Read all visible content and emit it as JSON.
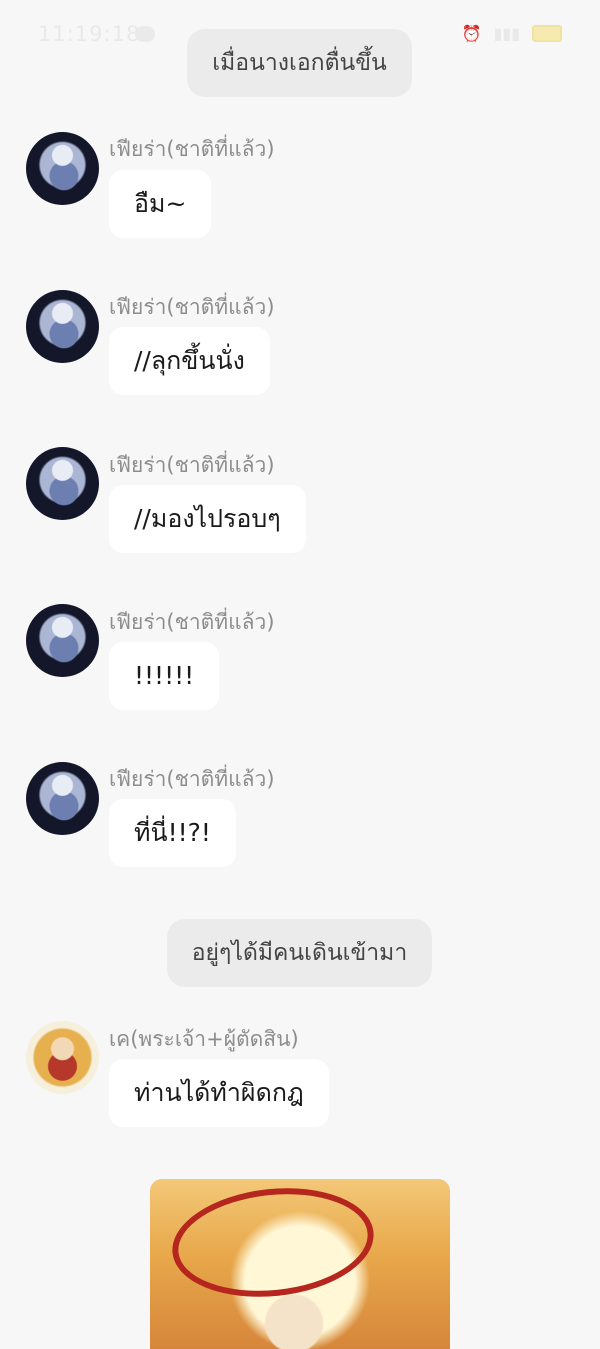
{
  "status_bar": {
    "time": "11:19:18",
    "battery": "85"
  },
  "system_messages": [
    "เมื่อนางเอกตื่นขึ้น",
    "อยู่ๆได้มีคนเดินเข้ามา"
  ],
  "messages": [
    {
      "sender": "เฟียร่า(ชาติที่แล้ว)",
      "text": "อืม~"
    },
    {
      "sender": "เฟียร่า(ชาติที่แล้ว)",
      "text": "//ลุกขึ้นนั่ง"
    },
    {
      "sender": "เฟียร่า(ชาติที่แล้ว)",
      "text": "//มองไปรอบๆ"
    },
    {
      "sender": "เฟียร่า(ชาติที่แล้ว)",
      "text": "!!!!!!"
    },
    {
      "sender": "เฟียร่า(ชาติที่แล้ว)",
      "text": "ที่นี่!!?!"
    },
    {
      "sender": "เค(พระเจ้า+ผู้ตัดสิน)",
      "text": "ท่านได้ทำผิดกฎ"
    }
  ],
  "icons": {
    "chat_app": "chat-bubble-icon",
    "battery": "battery-icon",
    "signal": "signal-icon",
    "avatar_fiora": "character-avatar",
    "avatar_k": "character-avatar"
  }
}
